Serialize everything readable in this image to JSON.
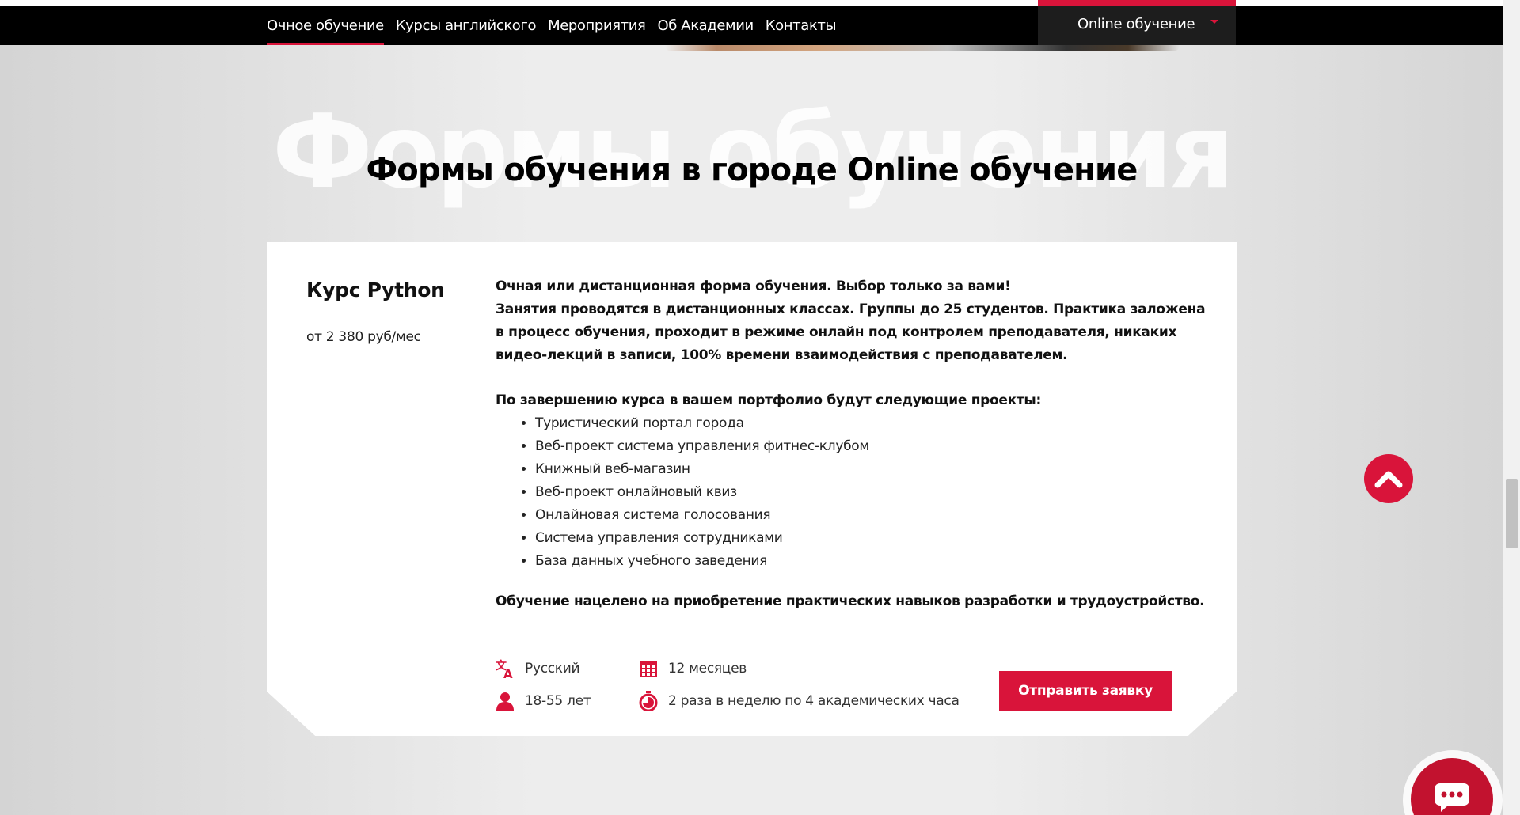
{
  "nav": {
    "items": [
      {
        "label": "Очное обучение",
        "active": true
      },
      {
        "label": "Курсы английского",
        "active": false
      },
      {
        "label": "Мероприятия",
        "active": false
      },
      {
        "label": "Об Академии",
        "active": false
      },
      {
        "label": "Контакты",
        "active": false
      }
    ],
    "city_select": {
      "value": "Online обучение"
    }
  },
  "section": {
    "background_title": "Формы обучения",
    "title": "Формы обучения в городе Online обучение"
  },
  "course": {
    "title": "Курс Python",
    "price": "от 2 380 руб/мес",
    "intro_line1": "Очная или дистанционная форма обучения. Выбор только за вами!",
    "intro_line2": "Занятия проводятся в дистанционных классах. Группы до 25 студентов. Практика заложена в процесс обучения, проходит в режиме онлайн под контролем преподавателя, никаких видео-лекций в записи, 100% времени взаимодействия с преподавателем.",
    "projects_heading": "По завершению курса в вашем портфолио будут следующие проекты:",
    "projects": [
      "Туристический портал города",
      "Веб-проект система управления фитнес-клубом",
      "Книжный веб-магазин",
      "Веб-проект онлайновый квиз",
      "Онлайновая система голосования",
      "Система управления сотрудниками",
      "База данных учебного заведения"
    ],
    "goal": "Обучение нацелено на приобретение практических навыков разработки и трудоустройство.",
    "language": "Русский",
    "age": "18-55 лет",
    "duration": "12 месяцев",
    "schedule": "2 раза в неделю по 4 академических часа",
    "apply_label": "Отправить заявку"
  },
  "icons": {
    "language": "translate-icon",
    "age": "person-icon",
    "duration": "calendar-icon",
    "schedule": "stopwatch-icon",
    "to_top": "chevron-up-icon",
    "chat": "chat-bubble-icon"
  },
  "colors": {
    "accent": "#d9143a",
    "nav_bg": "#000000",
    "select_bg": "#1d1d1d"
  }
}
